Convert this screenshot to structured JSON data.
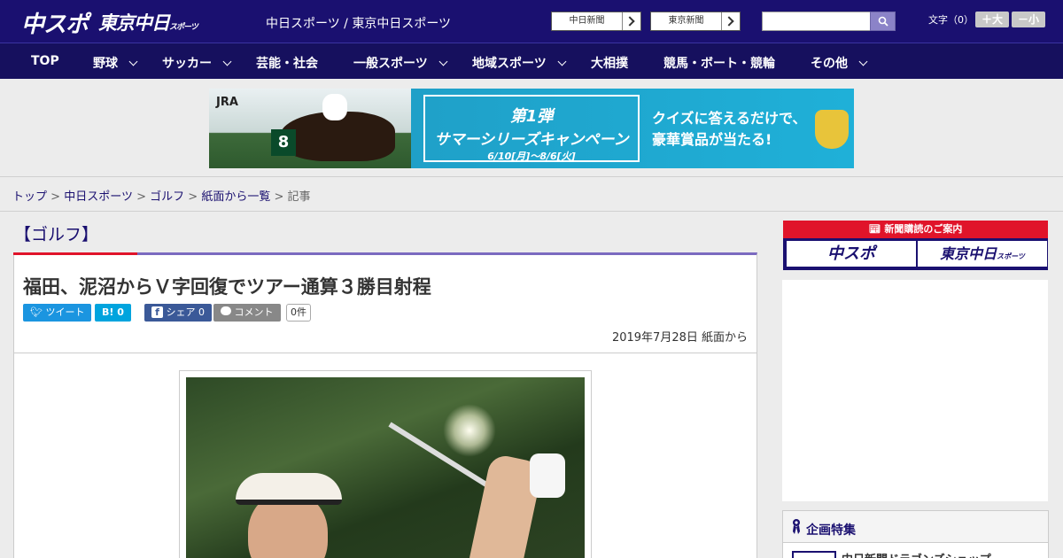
{
  "header": {
    "logo_primary": "中スポ",
    "logo_secondary": "東京中日",
    "logo_secondary_small": "スポーツ",
    "site_links": "中日スポーツ / 東京中日スポーツ",
    "paper_buttons": [
      "中日新聞",
      "東京新聞"
    ],
    "search": {
      "placeholder": "",
      "value": "",
      "icon": "search-icon"
    },
    "font_size_label": "文字（0）",
    "font_larger": "＋大",
    "font_smaller": "－小"
  },
  "nav": {
    "items": [
      {
        "label": "TOP",
        "dropdown": false
      },
      {
        "label": "野球",
        "dropdown": true
      },
      {
        "label": "サッカー",
        "dropdown": true
      },
      {
        "label": "芸能・社会",
        "dropdown": false
      },
      {
        "label": "一般スポーツ",
        "dropdown": true
      },
      {
        "label": "地域スポーツ",
        "dropdown": true
      },
      {
        "label": "大相撲",
        "dropdown": false
      },
      {
        "label": "競馬・ボート・競輪",
        "dropdown": false
      },
      {
        "label": "その他",
        "dropdown": true
      }
    ]
  },
  "banner": {
    "brand": "JRA",
    "horse_number": "8",
    "campaign_line1": "第1弾",
    "campaign_line2": "サマーシリーズキャンペーン",
    "campaign_dates": "6/10[月]～8/6[火]",
    "promo_line1": "クイズに答えるだけで、",
    "promo_line2": "豪華賞品が当たる!"
  },
  "breadcrumb": {
    "items": [
      "トップ",
      "中日スポーツ",
      "ゴルフ",
      "紙面から一覧"
    ],
    "current": "記事",
    "separator": ">"
  },
  "article": {
    "category": "【ゴルフ】",
    "headline": "福田、泥沼からＶ字回復でツアー通算３勝目射程",
    "share": {
      "tweet": "ツイート",
      "hatena": "B!",
      "hatena_count": "0",
      "facebook": "シェア",
      "facebook_count": "0",
      "comment": "コメント",
      "comment_count": "0件"
    },
    "dateline": "2019年7月28日 紙面から"
  },
  "sidebar": {
    "subscribe_header": "新聞購読のご案内",
    "subscribe_buttons": [
      "中スポ",
      "東京中日"
    ],
    "subscribe_small": "スポーツ",
    "feature_title": "企画特集",
    "feature_item": "中日新聞ドラゴンズショップ"
  },
  "colors": {
    "brand_navy": "#1a1070",
    "accent_red": "#e0142a",
    "twitter_blue": "#1b95e0",
    "hatena_blue": "#00a4de",
    "facebook_blue": "#3b5998",
    "comment_gray": "#888888"
  }
}
